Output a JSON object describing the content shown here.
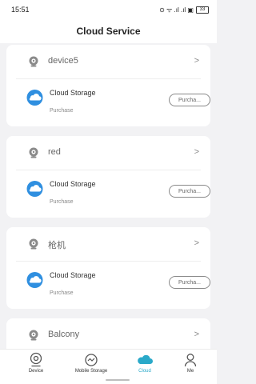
{
  "status_bar": {
    "time": "15:51",
    "network": "⊙ ᯤ .ıl .ıl ▣",
    "battery": "33"
  },
  "header": {
    "title": "Cloud Service"
  },
  "cards": [
    {
      "device_name": "device5",
      "service_title": "Cloud Storage",
      "service_subtitle": "Purchase",
      "button_label": "Purcha..."
    },
    {
      "device_name": "red",
      "service_title": "Cloud Storage",
      "service_subtitle": "Purchase",
      "button_label": "Purcha..."
    },
    {
      "device_name": "枪机",
      "service_title": "Cloud Storage",
      "service_subtitle": "Purchase",
      "button_label": "Purcha..."
    },
    {
      "device_name": "Balcony"
    }
  ],
  "bottom_nav": [
    {
      "label": "Device",
      "icon": "camera-icon"
    },
    {
      "label": "Mobile Storage",
      "icon": "storage-icon"
    },
    {
      "label": "Cloud",
      "icon": "cloud-icon",
      "active": true
    },
    {
      "label": "Me",
      "icon": "person-icon"
    }
  ],
  "colors": {
    "accent": "#2aa9c9",
    "cloud_blue": "#2f8fe0"
  }
}
